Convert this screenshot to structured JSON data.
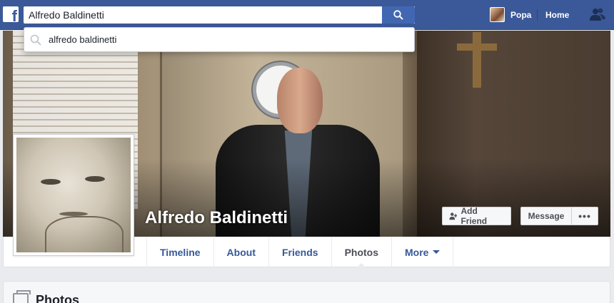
{
  "topbar": {
    "search_value": "Alfredo Baldinetti",
    "user_name": "Popa",
    "home_label": "Home",
    "brand_color": "#3b5998",
    "logo_letter": "f"
  },
  "search_suggestion": {
    "text": "alfredo baldinetti"
  },
  "profile": {
    "name": "Alfredo Baldinetti",
    "add_friend_label": "Add Friend",
    "message_label": "Message",
    "more_label": "•••"
  },
  "nav": {
    "tabs": [
      {
        "label": "Timeline"
      },
      {
        "label": "About"
      },
      {
        "label": "Friends"
      },
      {
        "label": "Photos"
      },
      {
        "label": "More"
      }
    ],
    "active_tab": "Photos"
  },
  "section": {
    "title": "Photos"
  }
}
